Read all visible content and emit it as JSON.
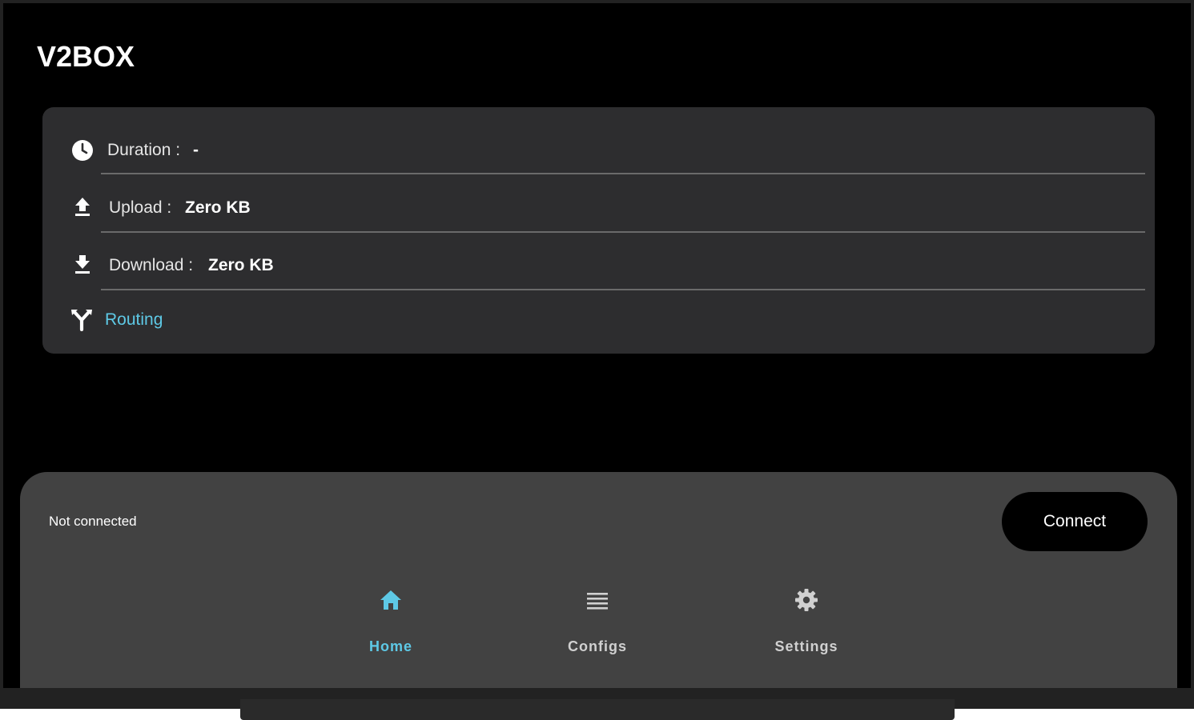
{
  "app": {
    "title": "V2BOX"
  },
  "stats": {
    "duration": {
      "label": "Duration :",
      "value": "-",
      "icon": "clock-icon"
    },
    "upload": {
      "label": "Upload :",
      "value": "Zero KB",
      "icon": "upload-icon"
    },
    "download": {
      "label": "Download :",
      "value": "Zero KB",
      "icon": "download-icon"
    },
    "routing": {
      "label": "Routing",
      "icon": "routing-icon"
    }
  },
  "connection": {
    "status": "Not connected",
    "button_label": "Connect"
  },
  "nav": {
    "items": [
      {
        "label": "Home",
        "icon": "home-icon",
        "active": true
      },
      {
        "label": "Configs",
        "icon": "list-icon",
        "active": false
      },
      {
        "label": "Settings",
        "icon": "gear-icon",
        "active": false
      }
    ]
  },
  "colors": {
    "accent": "#5ec9e6",
    "background": "#000000",
    "card": "#2d2d2f",
    "panel": "#424242",
    "inactive_nav": "#d0d0d0"
  }
}
